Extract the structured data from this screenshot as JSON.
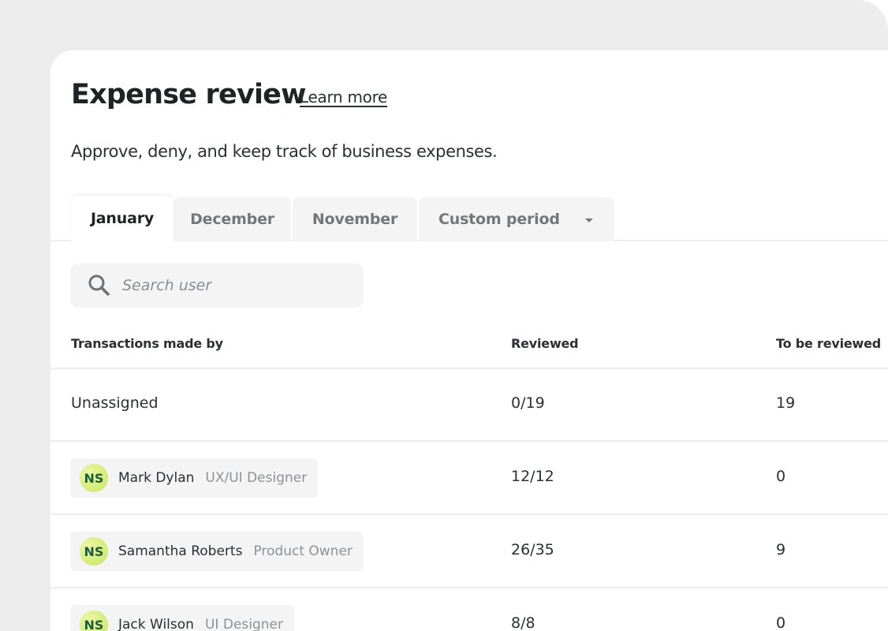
{
  "header": {
    "title": "Expense review",
    "learn_more": "Learn more",
    "subtitle": "Approve, deny, and keep track of business expenses."
  },
  "tabs": [
    {
      "label": "January",
      "active": true
    },
    {
      "label": "December",
      "active": false
    },
    {
      "label": "November",
      "active": false
    },
    {
      "label": "Custom period",
      "active": false
    }
  ],
  "search": {
    "placeholder": "Search user",
    "value": "",
    "icon": "search-icon"
  },
  "table": {
    "columns": [
      "Transactions made by",
      "Reviewed",
      "To be reviewed"
    ],
    "rows": [
      {
        "user": "Unassigned",
        "reviewed": "0/19",
        "to_be_reviewed": "19"
      },
      {
        "initials": "NS",
        "user": "Mark Dylan",
        "role": "UX/UI Designer",
        "reviewed": "12/12",
        "to_be_reviewed": "0"
      },
      {
        "initials": "NS",
        "user": "Samantha Roberts",
        "role": "Product Owner",
        "reviewed": "26/35",
        "to_be_reviewed": "9"
      },
      {
        "initials": "NS",
        "user": "Jack Wilson",
        "role": "UI Designer",
        "reviewed": "8/8",
        "to_be_reviewed": "0"
      }
    ]
  },
  "colors": {
    "background": "#ededed",
    "card": "#ffffff",
    "text": "#1f2326",
    "muted": "#74777a",
    "chip": "#f4f4f4",
    "avatar": "#d6ee7c",
    "avatar_text": "#1d5d3b"
  }
}
